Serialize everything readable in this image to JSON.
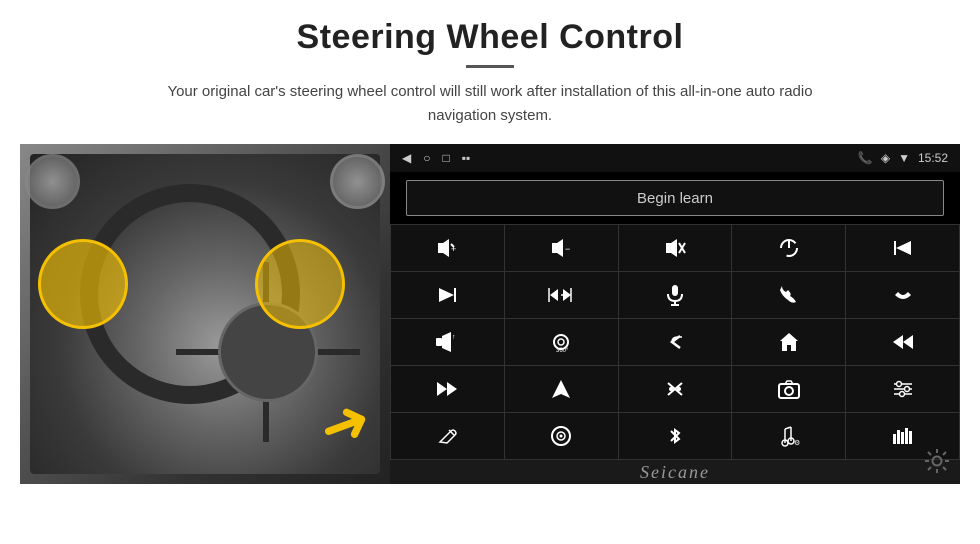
{
  "page": {
    "title": "Steering Wheel Control",
    "subtitle": "Your original car's steering wheel control will still work after installation of this all-in-one auto radio navigation system.",
    "title_underline": true
  },
  "screen": {
    "begin_learn_label": "Begin learn",
    "time": "15:52",
    "watermark": "Seicane"
  },
  "controls": [
    {
      "icon": "🔊+",
      "label": "volume-up"
    },
    {
      "icon": "🔊−",
      "label": "volume-down"
    },
    {
      "icon": "🔇",
      "label": "mute"
    },
    {
      "icon": "⏻",
      "label": "power"
    },
    {
      "icon": "⏮",
      "label": "prev-track"
    },
    {
      "icon": "⏭",
      "label": "next-track"
    },
    {
      "icon": "✂⏭",
      "label": "skip"
    },
    {
      "icon": "🎤",
      "label": "mic"
    },
    {
      "icon": "📞",
      "label": "call"
    },
    {
      "icon": "↩",
      "label": "hang-up"
    },
    {
      "icon": "📢",
      "label": "speaker"
    },
    {
      "icon": "360°",
      "label": "camera-360"
    },
    {
      "icon": "↩",
      "label": "back"
    },
    {
      "icon": "🏠",
      "label": "home"
    },
    {
      "icon": "⏮⏮",
      "label": "rewind"
    },
    {
      "icon": "⏭⏭",
      "label": "fast-forward"
    },
    {
      "icon": "▶",
      "label": "navigate"
    },
    {
      "icon": "⇌",
      "label": "equalizer"
    },
    {
      "icon": "📷",
      "label": "camera"
    },
    {
      "icon": "🎚",
      "label": "settings-sliders"
    },
    {
      "icon": "✏",
      "label": "edit"
    },
    {
      "icon": "⊙",
      "label": "circle-target"
    },
    {
      "icon": "✱",
      "label": "bluetooth"
    },
    {
      "icon": "🎵",
      "label": "music"
    },
    {
      "icon": "📊",
      "label": "equalizer-bars"
    }
  ],
  "status_bar": {
    "back_arrow": "◀",
    "home_circle": "○",
    "square": "□",
    "bars": "▪▪",
    "phone_icon": "📞",
    "location_icon": "◈",
    "wifi_icon": "▼",
    "time": "15:52"
  }
}
